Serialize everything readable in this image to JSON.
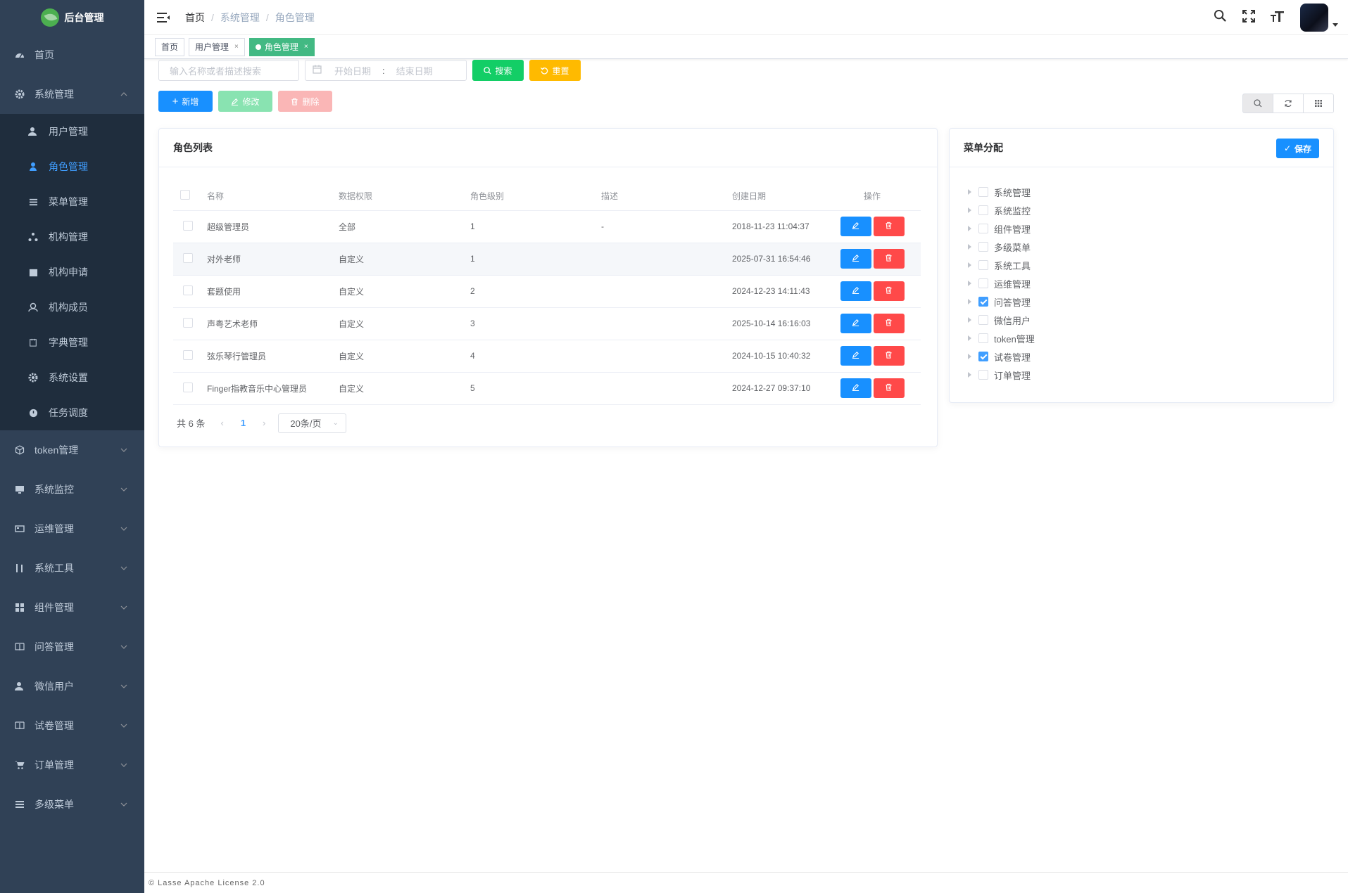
{
  "sidebar": {
    "logo": "后台管理",
    "items": [
      {
        "label": "首页",
        "icon": "dashboard-icon"
      },
      {
        "label": "系统管理",
        "icon": "gear-icon",
        "expanded": true,
        "children": [
          {
            "label": "用户管理",
            "icon": "user-icon"
          },
          {
            "label": "角色管理",
            "icon": "role-icon",
            "active": true
          },
          {
            "label": "菜单管理",
            "icon": "list-icon"
          },
          {
            "label": "机构管理",
            "icon": "tree-icon"
          },
          {
            "label": "机构申请",
            "icon": "calendar-icon"
          },
          {
            "label": "机构成员",
            "icon": "peoples-icon"
          },
          {
            "label": "字典管理",
            "icon": "dict-icon"
          },
          {
            "label": "系统设置",
            "icon": "setting-icon"
          },
          {
            "label": "任务调度",
            "icon": "timer-icon"
          }
        ]
      },
      {
        "label": "token管理",
        "icon": "cube-icon"
      },
      {
        "label": "系统监控",
        "icon": "monitor-icon"
      },
      {
        "label": "运维管理",
        "icon": "server-icon"
      },
      {
        "label": "系统工具",
        "icon": "tool-icon"
      },
      {
        "label": "组件管理",
        "icon": "component-icon"
      },
      {
        "label": "问答管理",
        "icon": "book-icon"
      },
      {
        "label": "微信用户",
        "icon": "wechat-user-icon"
      },
      {
        "label": "试卷管理",
        "icon": "exam-icon"
      },
      {
        "label": "订单管理",
        "icon": "cart-icon"
      },
      {
        "label": "多级菜单",
        "icon": "multilevel-icon"
      }
    ]
  },
  "breadcrumb": [
    "首页",
    "系统管理",
    "角色管理"
  ],
  "tags": [
    {
      "label": "首页"
    },
    {
      "label": "用户管理"
    },
    {
      "label": "角色管理",
      "active": true
    }
  ],
  "search": {
    "placeholder": "输入名称或者描述搜索",
    "start_date": "开始日期",
    "separator": ":",
    "end_date": "结束日期",
    "search_label": "搜索",
    "reset_label": "重置"
  },
  "actions": {
    "add": "新增",
    "edit": "修改",
    "delete": "删除"
  },
  "role_table": {
    "title": "角色列表",
    "columns": [
      "名称",
      "数据权限",
      "角色级别",
      "描述",
      "创建日期",
      "操作"
    ],
    "rows": [
      {
        "name": "超级管理员",
        "scope": "全部",
        "level": "1",
        "desc": "-",
        "created": "2018-11-23 11:04:37"
      },
      {
        "name": "对外老师",
        "scope": "自定义",
        "level": "1",
        "desc": "",
        "created": "2025-07-31 16:54:46"
      },
      {
        "name": "套题使用",
        "scope": "自定义",
        "level": "2",
        "desc": "",
        "created": "2024-12-23 14:11:43"
      },
      {
        "name": "声粤艺术老师",
        "scope": "自定义",
        "level": "3",
        "desc": "",
        "created": "2025-10-14 16:16:03"
      },
      {
        "name": "弦乐琴行管理员",
        "scope": "自定义",
        "level": "4",
        "desc": "",
        "created": "2024-10-15 10:40:32"
      },
      {
        "name": "Finger指教音乐中心管理员",
        "scope": "自定义",
        "level": "5",
        "desc": "",
        "created": "2024-12-27 09:37:10"
      }
    ],
    "pager": {
      "total": "共 6 条",
      "current": "1",
      "size": "20条/页"
    }
  },
  "menu_panel": {
    "title": "菜单分配",
    "save_label": "保存",
    "nodes": [
      {
        "label": "系统管理",
        "checked": false
      },
      {
        "label": "系统监控",
        "checked": false
      },
      {
        "label": "组件管理",
        "checked": false
      },
      {
        "label": "多级菜单",
        "checked": false
      },
      {
        "label": "系统工具",
        "checked": false
      },
      {
        "label": "运维管理",
        "checked": false
      },
      {
        "label": "问答管理",
        "checked": true
      },
      {
        "label": "微信用户",
        "checked": false
      },
      {
        "label": "token管理",
        "checked": false
      },
      {
        "label": "试卷管理",
        "checked": true
      },
      {
        "label": "订单管理",
        "checked": false
      }
    ]
  },
  "footer": "© Lasse Apache License 2.0",
  "colors": {
    "sidebar": "#304156",
    "submenu": "#1f2d3d",
    "active": "#409eff",
    "tag_active": "#42b983"
  }
}
